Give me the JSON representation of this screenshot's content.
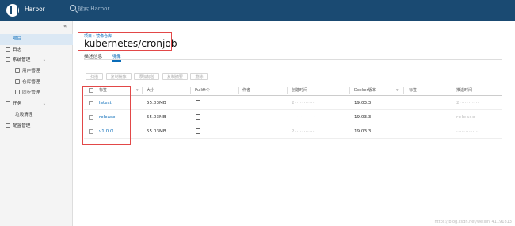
{
  "topbar": {
    "brand": "Harbor",
    "search_placeholder": "搜索 Harbor..."
  },
  "sidebar": {
    "collapse": "«",
    "items": [
      {
        "label": "项目",
        "active": true
      },
      {
        "label": "日志"
      },
      {
        "label": "系统管理"
      },
      {
        "label": "用户管理",
        "sub": true
      },
      {
        "label": "仓库管理",
        "sub": true
      },
      {
        "label": "同步管理",
        "sub": true
      },
      {
        "label": "任务"
      },
      {
        "label": "垃圾清理",
        "sub": true
      },
      {
        "label": "配置管理"
      }
    ]
  },
  "main": {
    "breadcrumb": "项目 ‹ 镜像仓库",
    "title": "kubernetes/cronjob",
    "tabs": [
      "描述信息",
      "镜像"
    ],
    "toolbar": [
      "扫描",
      "复制镜像",
      "添加标签",
      "复制摘要",
      "删除"
    ],
    "columns": [
      "标签",
      "大小",
      "Pull命令",
      "作者",
      "创建时间",
      "Docker版本",
      "标签",
      "推送时间"
    ],
    "rows": [
      {
        "tag": "latest",
        "size": "55.03MB",
        "created": "2···········",
        "docker": "19.03.3",
        "pushed": "2···········"
      },
      {
        "tag": "release",
        "size": "55.03MB",
        "created": "·············",
        "docker": "19.03.3",
        "pushed": "release·······"
      },
      {
        "tag": "v1.0.0",
        "size": "55.03MB",
        "created": "2···········",
        "docker": "19.03.3",
        "pushed": "·············"
      }
    ]
  },
  "watermark": "https://blog.csdn.net/weixin_41191813"
}
